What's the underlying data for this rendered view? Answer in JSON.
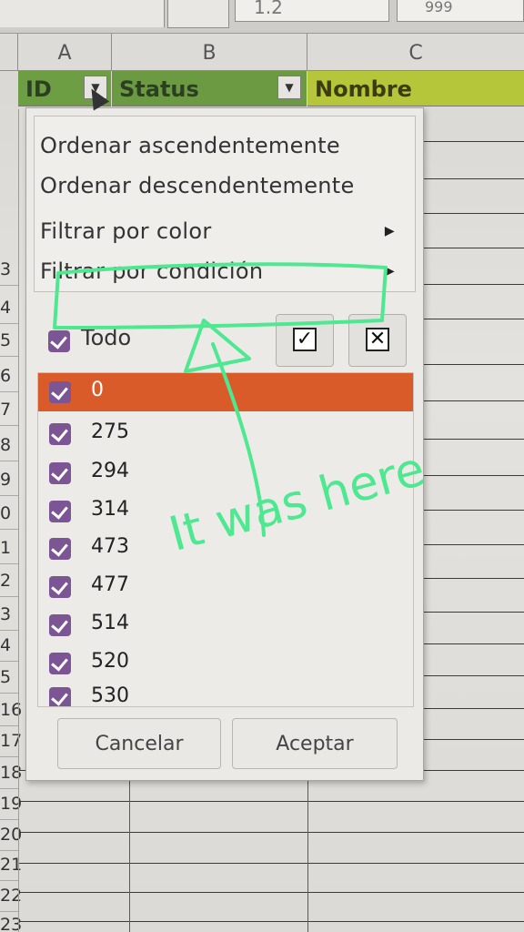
{
  "toolbar": {
    "formula_text": "1.2",
    "formula_text2": "999"
  },
  "columns": {
    "a": "A",
    "b": "B",
    "c": "C"
  },
  "header_row": {
    "id": "ID",
    "status": "Status",
    "nombre": "Nombre"
  },
  "row_numbers": [
    "3",
    "4",
    "5",
    "6",
    "7",
    "8",
    "9",
    "0",
    "1",
    "2",
    "3",
    "4",
    "5",
    "16",
    "17",
    "18",
    "19",
    "20",
    "21",
    "22",
    "23"
  ],
  "filter_menu": {
    "sort_asc": "Ordenar ascendentemente",
    "sort_desc": "Ordenar descendentemente",
    "filter_color": "Filtrar por color",
    "filter_condition": "Filtrar por condición"
  },
  "todo_label": "Todo",
  "values": [
    "0",
    "275",
    "294",
    "314",
    "473",
    "477",
    "514",
    "520",
    "530"
  ],
  "buttons": {
    "cancel": "Cancelar",
    "accept": "Aceptar"
  },
  "annotation": {
    "text": "It was here",
    "color": "#4de88f"
  },
  "colors": {
    "selected": "#d95b2a",
    "checkbox": "#7b5594",
    "id_header": "#6e9e43",
    "nombre_header": "#b5c63a"
  },
  "icons": {
    "select_all": "checkmark-icon",
    "unselect_all": "x-icon",
    "submenu": "triangle-right-icon"
  }
}
